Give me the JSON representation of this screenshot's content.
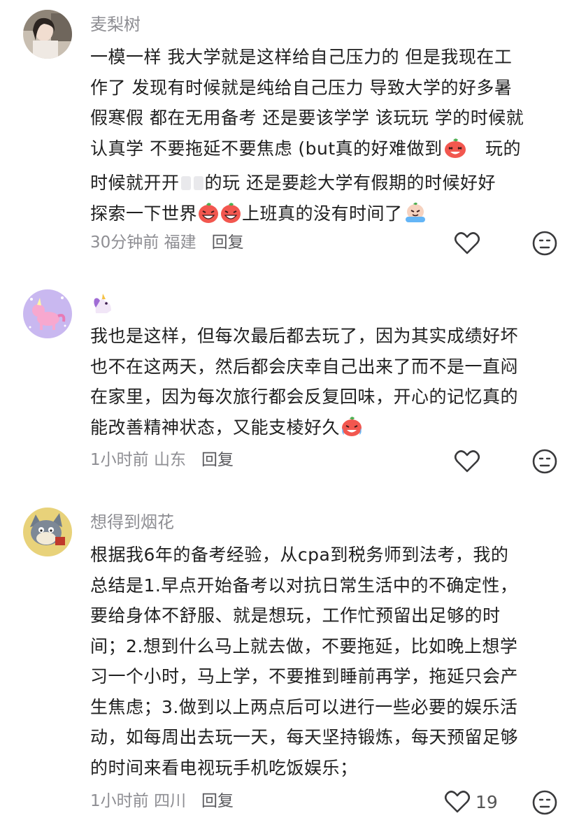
{
  "comments": [
    {
      "username": "麦梨树",
      "lines": [
        "一模一样 我大学就是这样给自己压力的 但是我现在工",
        "作了 发现有时候就是纯给自己压力 导致大学的好多暑",
        "假寒假 都在无用备考 还是要该学学 该玩玩 学的时候就",
        "认真学 不要拖延不要焦虑 (but真的好难做到",
        "玩的",
        "时候就开开",
        "的玩 还是要趁大学有假期的时候好好",
        "探索一下世界",
        "上班真的没有时间了"
      ],
      "time": "30分钟前",
      "location": "福建",
      "reply": "回复",
      "likes": ""
    },
    {
      "username": "",
      "username_icon": "unicorn-emoji",
      "lines": [
        "我也是这样，但每次最后都去玩了，因为其实成绩好坏",
        "也不在这两天，然后都会庆幸自己出来了而不是一直闷",
        "在家里，因为每次旅行都会反复回味，开心的记忆真的",
        "能改善精神状态，又能支棱好久"
      ],
      "time": "1小时前",
      "location": "山东",
      "reply": "回复",
      "likes": ""
    },
    {
      "username": "想得到烟花",
      "lines": [
        "根据我6年的备考经验，从cpa到税务师到法考，我的",
        "总结是1.早点开始备考以对抗日常生活中的不确定性，",
        "要给身体不舒服、就是想玩，工作忙预留出足够的时",
        "间；2.想到什么马上就去做，不要拖延，比如晚上想学",
        "习一个小时，马上学，不要推到睡前再学，拖延只会产",
        "生焦虑；3.做到以上两点后可以进行一些必要的娱乐活",
        "动，如每周出去玩一天，每天坚持锻炼，每天预留足够",
        "的时间来看电视玩手机吃饭娱乐；"
      ],
      "time": "1小时前",
      "location": "四川",
      "reply": "回复",
      "likes": "19"
    }
  ],
  "icons": {
    "like": "heart-outline-icon",
    "dislike": "meh-face-icon",
    "emoji_laugh": "laughing-emoji",
    "emoji_grin": "grinning-emoji",
    "emoji_tears": "crying-laughing-emoji"
  },
  "colors": {
    "meta_gray": "#8e8e93",
    "text": "#1f1f1f",
    "emoji_red": "#f2574f"
  }
}
